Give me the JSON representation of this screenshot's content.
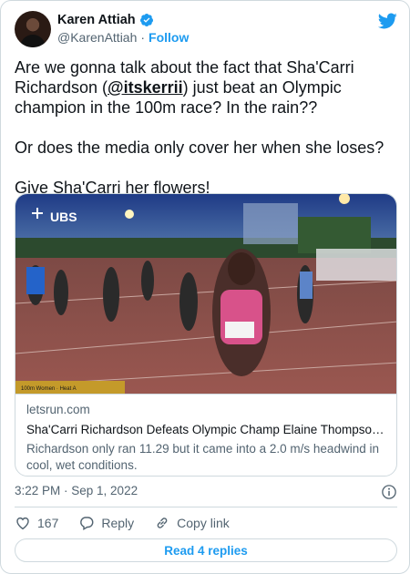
{
  "author": {
    "name": "Karen Attiah",
    "handle": "@KarenAttiah",
    "separator": "·",
    "follow_label": "Follow"
  },
  "tweet": {
    "line1_pre": "Are we gonna talk about the fact that Sha'Carri Richardson  (",
    "mention": "@itskerrii",
    "line1_post": ") just beat an Olympic champion in the 100m race? In the rain??",
    "paragraph2": "Or does the media only cover her when she loses?",
    "paragraph3": "Give Sha'Carri her flowers!"
  },
  "link_card": {
    "photo_logo": "UBS",
    "photo_caption": "100m Women · Heat A",
    "domain": "letsrun.com",
    "title": "Sha'Carri Richardson Defeats Olympic Champ Elaine Thompson-Her...",
    "description": "Richardson only ran 11.29 but it came into a 2.0 m/s headwind in cool, wet conditions."
  },
  "meta": {
    "timestamp": "3:22 PM · Sep 1, 2022"
  },
  "actions": {
    "like_count": "167",
    "reply_label": "Reply",
    "copy_link_label": "Copy link"
  },
  "replies_button": "Read 4 replies",
  "colors": {
    "accent": "#1d9bf0",
    "text": "#0f1419",
    "muted": "#536471",
    "border": "#cfd9de"
  }
}
